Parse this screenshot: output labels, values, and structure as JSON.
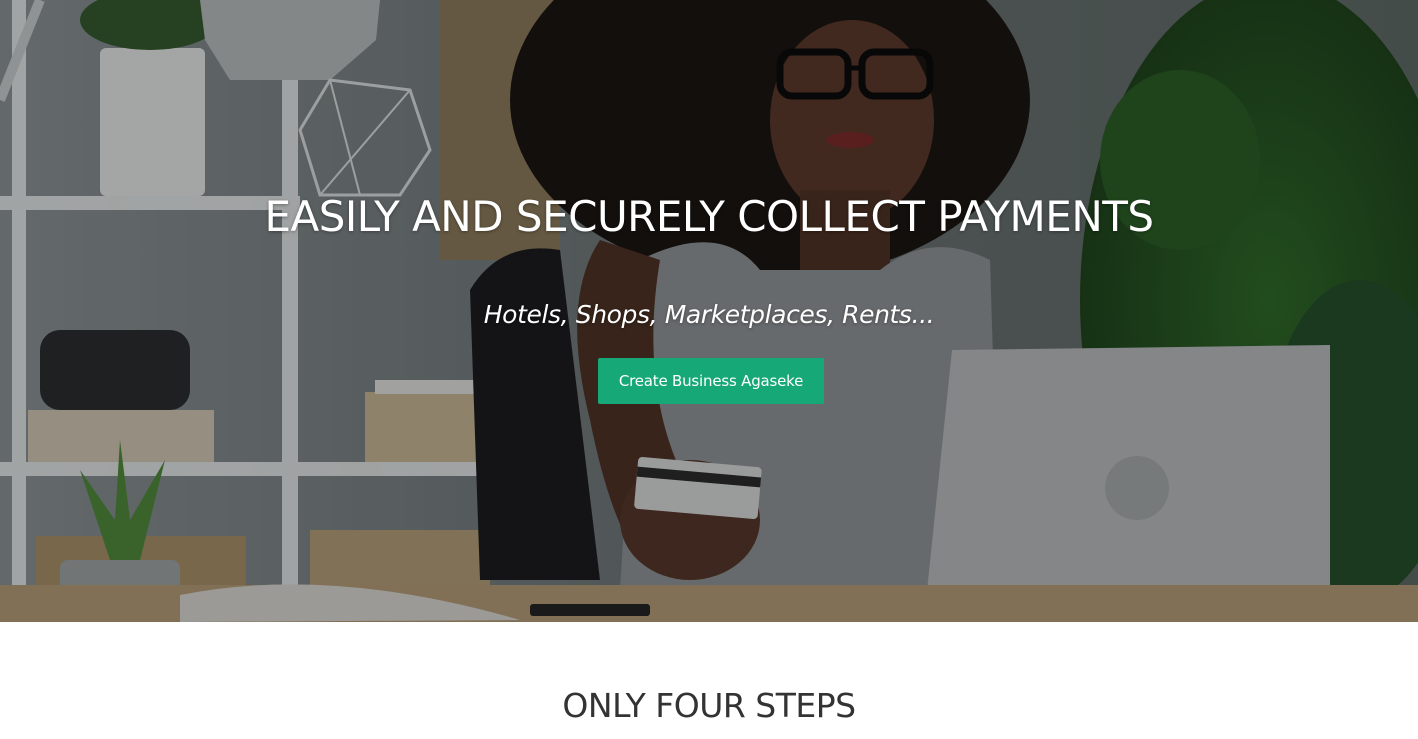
{
  "hero": {
    "title": "EASILY AND SECURELY COLLECT PAYMENTS",
    "subtitle": "Hotels, Shops, Marketplaces, Rents...",
    "cta_label": "Create Business Agaseke",
    "cta_color": "#17a878"
  },
  "steps": {
    "title": "ONLY FOUR STEPS"
  }
}
